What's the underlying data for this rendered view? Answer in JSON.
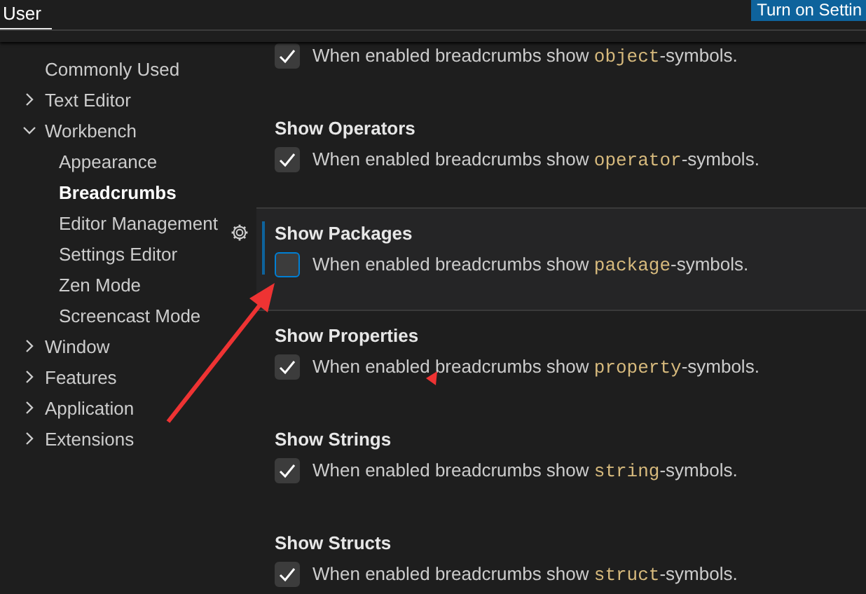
{
  "header": {
    "tabs": [
      {
        "label": "User",
        "selected": true
      }
    ],
    "button": "Turn on Settin"
  },
  "sidebar": {
    "items": [
      {
        "label": "Commonly Used",
        "selected": false
      },
      {
        "label": "Text Editor",
        "expanded": false,
        "selected": false
      },
      {
        "label": "Workbench",
        "expanded": true,
        "selected": false,
        "children": [
          {
            "label": "Appearance",
            "selected": false
          },
          {
            "label": "Breadcrumbs",
            "selected": true
          },
          {
            "label": "Editor Management",
            "selected": false
          },
          {
            "label": "Settings Editor",
            "selected": false
          },
          {
            "label": "Zen Mode",
            "selected": false
          },
          {
            "label": "Screencast Mode",
            "selected": false
          }
        ]
      },
      {
        "label": "Window",
        "expanded": false,
        "selected": false
      },
      {
        "label": "Features",
        "expanded": false,
        "selected": false
      },
      {
        "label": "Application",
        "expanded": false,
        "selected": false
      },
      {
        "label": "Extensions",
        "expanded": false,
        "selected": false
      }
    ]
  },
  "settings": [
    {
      "description": {
        "before": "When enabled breadcrumbs show ",
        "code": "object",
        "after": "-symbols."
      },
      "checked": true,
      "focused": false
    },
    {
      "title": "Show Operators",
      "description": {
        "before": "When enabled breadcrumbs show ",
        "code": "operator",
        "after": "-symbols."
      },
      "checked": true,
      "focused": false
    },
    {
      "title": "Show Packages",
      "description": {
        "before": "When enabled breadcrumbs show ",
        "code": "package",
        "after": "-symbols."
      },
      "checked": false,
      "focused": true
    },
    {
      "title": "Show Properties",
      "description": {
        "before": "When enabled breadcrumbs show ",
        "code": "property",
        "after": "-symbols."
      },
      "checked": true,
      "focused": false
    },
    {
      "title": "Show Strings",
      "description": {
        "before": "When enabled breadcrumbs show ",
        "code": "string",
        "after": "-symbols."
      },
      "checked": true,
      "focused": false
    },
    {
      "title": "Show Structs",
      "description": {
        "before": "When enabled breadcrumbs show ",
        "code": "struct",
        "after": "-symbols."
      },
      "checked": true,
      "focused": false
    }
  ]
}
